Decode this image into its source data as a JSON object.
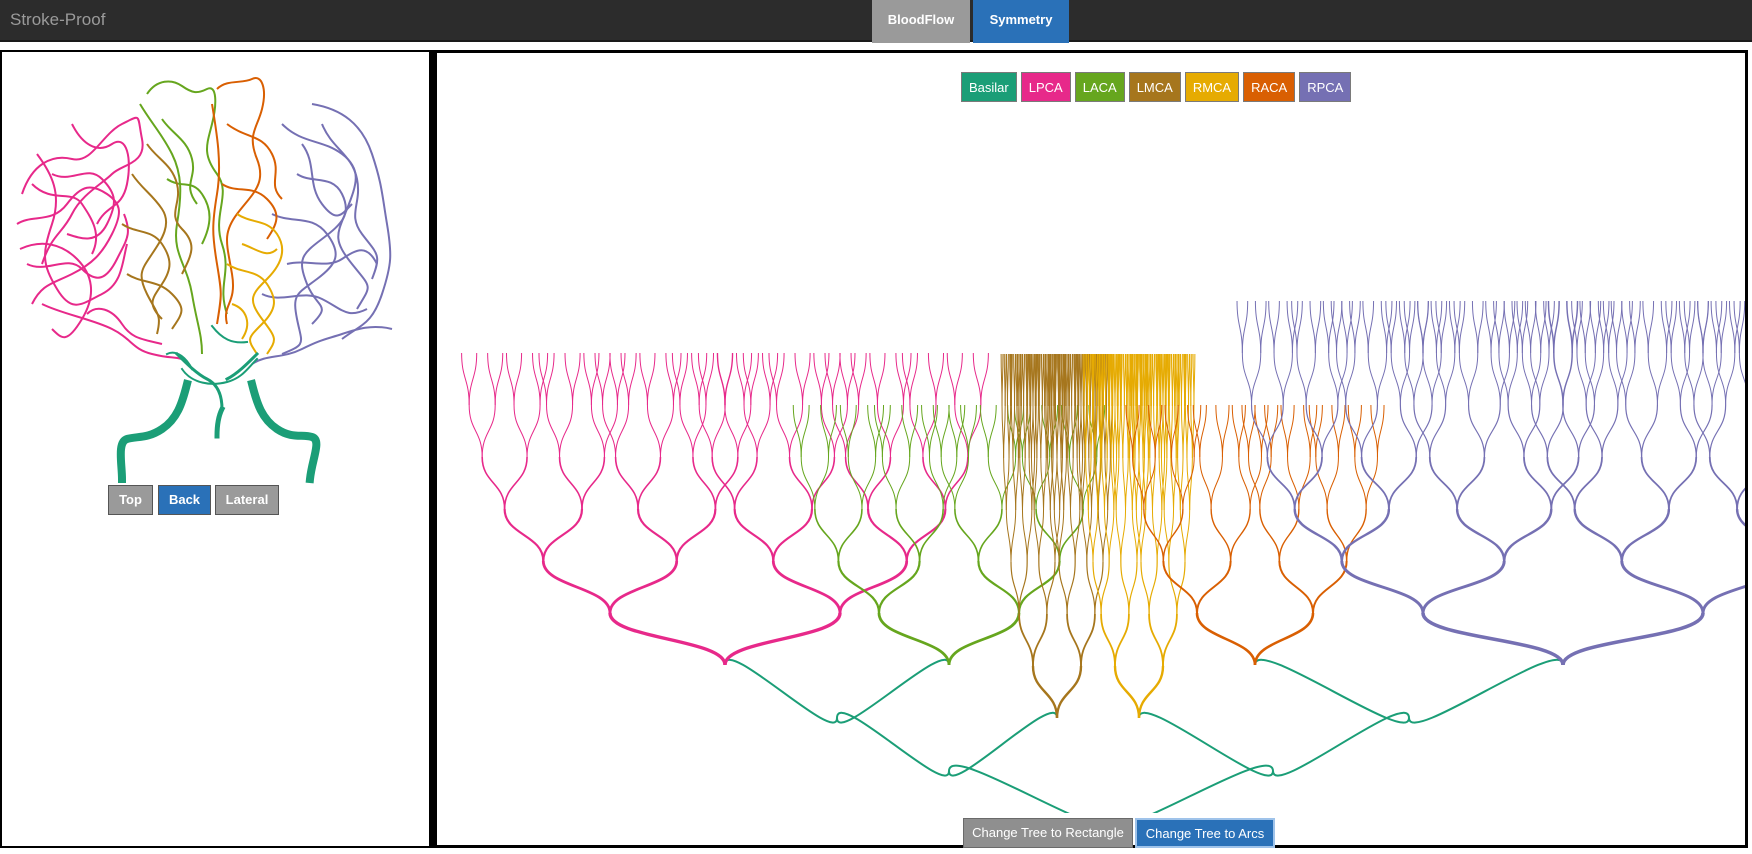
{
  "header": {
    "app_title": "Stroke-Proof",
    "tabs": [
      {
        "label": "BloodFlow",
        "active": false
      },
      {
        "label": "Symmetry",
        "active": true
      }
    ]
  },
  "left_panel": {
    "view_buttons": [
      {
        "label": "Top",
        "active": false
      },
      {
        "label": "Back",
        "active": true
      },
      {
        "label": "Lateral",
        "active": false
      }
    ]
  },
  "legend": [
    {
      "label": "Basilar",
      "color": "#1b9e77"
    },
    {
      "label": "LPCA",
      "color": "#e7298a"
    },
    {
      "label": "LACA",
      "color": "#66a61e"
    },
    {
      "label": "LMCA",
      "color": "#a6761d"
    },
    {
      "label": "RMCA",
      "color": "#e6ab02"
    },
    {
      "label": "RACA",
      "color": "#d95f02"
    },
    {
      "label": "RPCA",
      "color": "#7570b3"
    }
  ],
  "controls": {
    "rectangle_label": "Change Tree to Rectangle",
    "arcs_label": "Change Tree to Arcs"
  },
  "colors": {
    "header_bg": "#2c2c2c",
    "active_blue": "#2a71b8",
    "inactive_gray": "#9a9a9a"
  }
}
